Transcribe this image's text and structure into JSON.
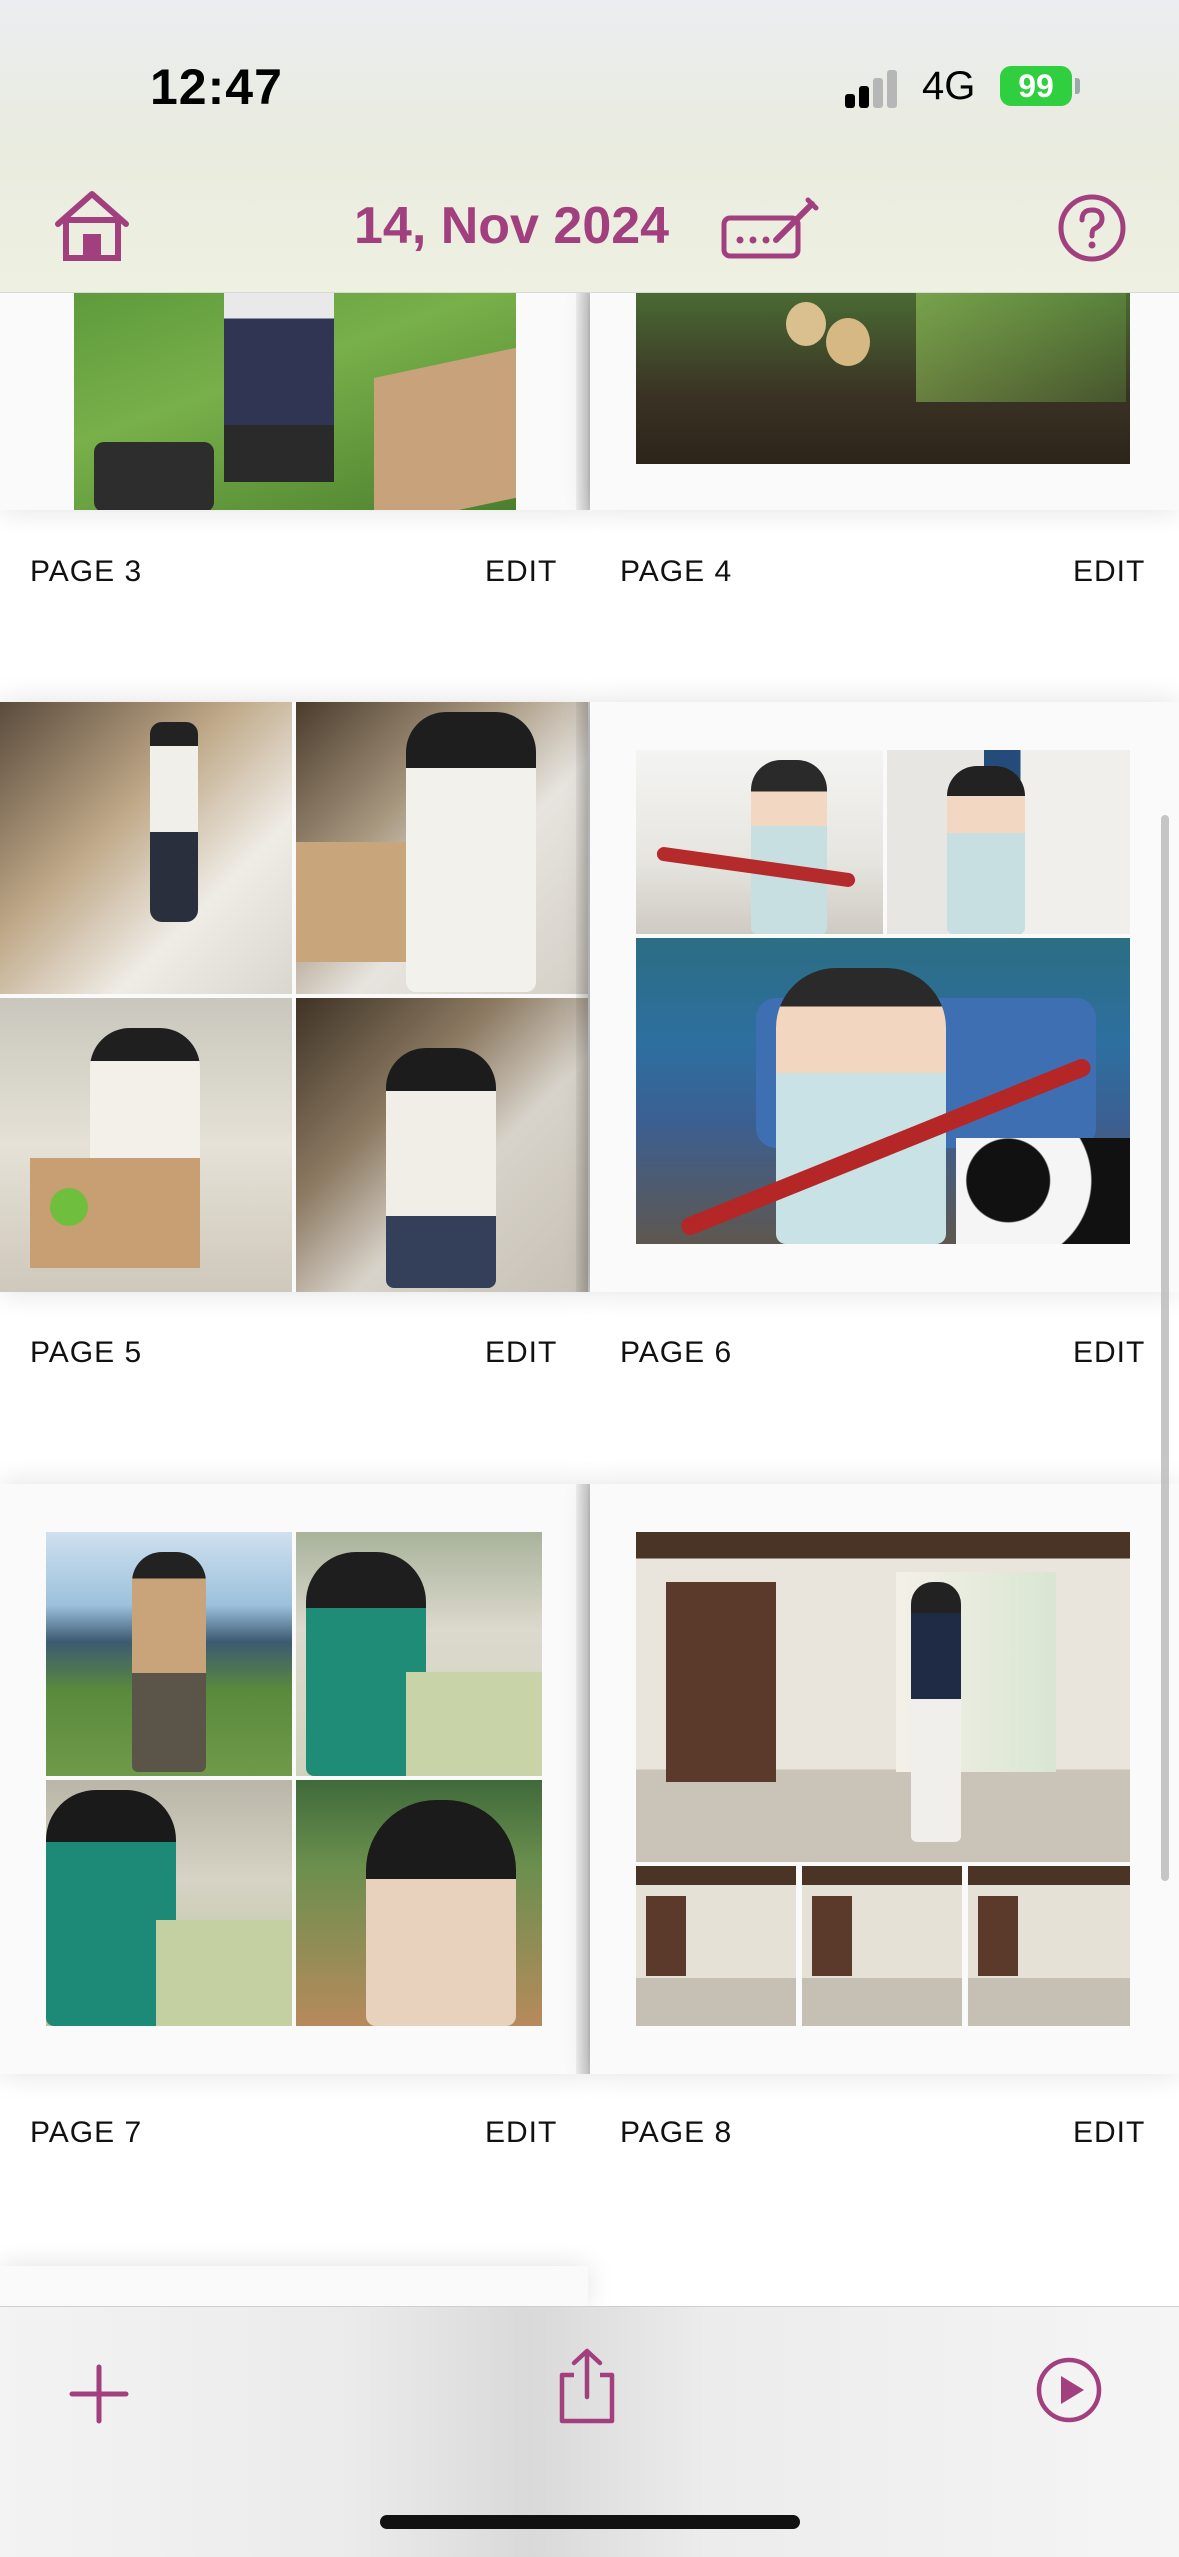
{
  "status_bar": {
    "time": "12:47",
    "network": "4G",
    "battery": "99"
  },
  "header": {
    "title": "14, Nov 2024"
  },
  "icons": {
    "home": "home-icon",
    "edit_title": "pencil-keyboard-icon",
    "help": "question-circle-icon",
    "add": "plus-icon",
    "share": "share-icon",
    "play": "play-circle-icon"
  },
  "colors": {
    "accent": "#a2407f",
    "battery": "#2fcf3f"
  },
  "pages": [
    {
      "label": "PAGE 3",
      "edit": "EDIT"
    },
    {
      "label": "PAGE 4",
      "edit": "EDIT"
    },
    {
      "label": "PAGE 5",
      "edit": "EDIT"
    },
    {
      "label": "PAGE 6",
      "edit": "EDIT"
    },
    {
      "label": "PAGE 7",
      "edit": "EDIT"
    },
    {
      "label": "PAGE 8",
      "edit": "EDIT"
    }
  ]
}
